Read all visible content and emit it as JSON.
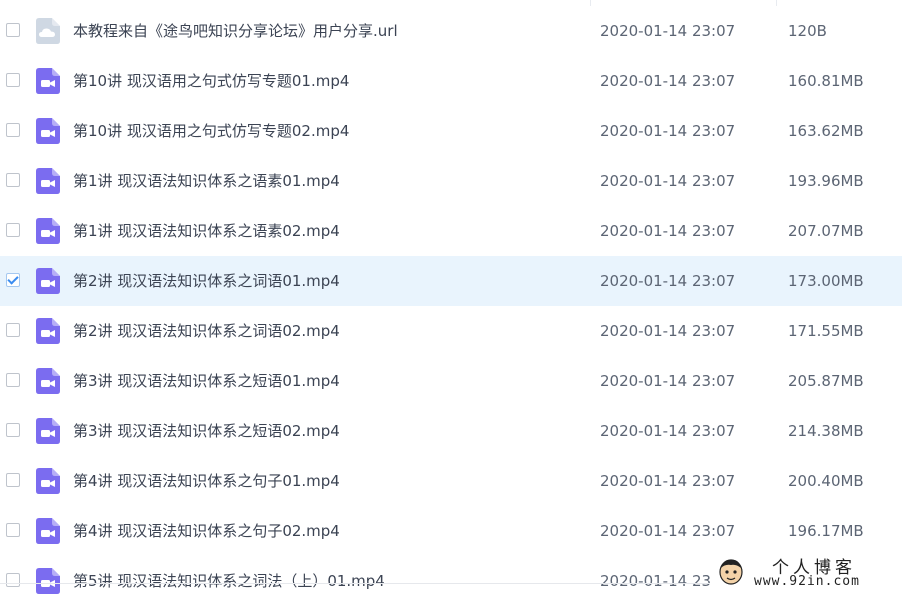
{
  "colors": {
    "selected_row_bg": "#e9f4fd",
    "video_icon": "#7b6cf0",
    "link_icon": "#cfd8e3",
    "checkbox_tick": "#3b8cf0"
  },
  "files": [
    {
      "name": "本教程来自《途鸟吧知识分享论坛》用户分享.url",
      "date": "2020-01-14 23:07",
      "size": "120B",
      "icon": "link-file-icon",
      "selected": false
    },
    {
      "name": "第10讲 现汉语用之句式仿写专题01.mp4",
      "date": "2020-01-14 23:07",
      "size": "160.81MB",
      "icon": "video-file-icon",
      "selected": false
    },
    {
      "name": "第10讲 现汉语用之句式仿写专题02.mp4",
      "date": "2020-01-14 23:07",
      "size": "163.62MB",
      "icon": "video-file-icon",
      "selected": false
    },
    {
      "name": "第1讲 现汉语法知识体系之语素01.mp4",
      "date": "2020-01-14 23:07",
      "size": "193.96MB",
      "icon": "video-file-icon",
      "selected": false
    },
    {
      "name": "第1讲 现汉语法知识体系之语素02.mp4",
      "date": "2020-01-14 23:07",
      "size": "207.07MB",
      "icon": "video-file-icon",
      "selected": false
    },
    {
      "name": "第2讲 现汉语法知识体系之词语01.mp4",
      "date": "2020-01-14 23:07",
      "size": "173.00MB",
      "icon": "video-file-icon",
      "selected": true
    },
    {
      "name": "第2讲 现汉语法知识体系之词语02.mp4",
      "date": "2020-01-14 23:07",
      "size": "171.55MB",
      "icon": "video-file-icon",
      "selected": false
    },
    {
      "name": "第3讲 现汉语法知识体系之短语01.mp4",
      "date": "2020-01-14 23:07",
      "size": "205.87MB",
      "icon": "video-file-icon",
      "selected": false
    },
    {
      "name": "第3讲 现汉语法知识体系之短语02.mp4",
      "date": "2020-01-14 23:07",
      "size": "214.38MB",
      "icon": "video-file-icon",
      "selected": false
    },
    {
      "name": "第4讲 现汉语法知识体系之句子01.mp4",
      "date": "2020-01-14 23:07",
      "size": "200.40MB",
      "icon": "video-file-icon",
      "selected": false
    },
    {
      "name": "第4讲 现汉语法知识体系之句子02.mp4",
      "date": "2020-01-14 23:07",
      "size": "196.17MB",
      "icon": "video-file-icon",
      "selected": false
    },
    {
      "name": "第5讲 现汉语法知识体系之词法（上）01.mp4",
      "date": "2020-01-14 23:07",
      "size": "",
      "icon": "video-file-icon",
      "selected": false
    }
  ],
  "watermark": {
    "title": "个人博客",
    "url": "www.92in.com"
  }
}
